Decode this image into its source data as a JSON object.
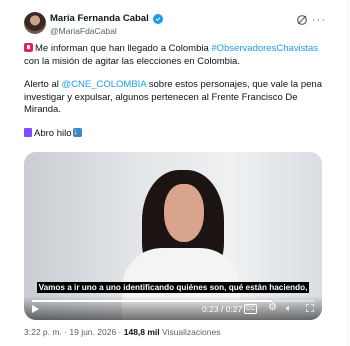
{
  "author": {
    "name": "María Fernanda Cabal",
    "handle": "@MariaFdaCabal",
    "verified_color": "#1d9bf0"
  },
  "header_icons": [
    "grok-icon",
    "more-icon"
  ],
  "tweet": {
    "line1_pre": "Me informan que han llegado a Colombia ",
    "line1_hashtag": "#ObservadoresChavistas",
    "line1_post": " con la misión de agitar las elecciones en Colombia.",
    "line2_pre": "Alerto al ",
    "line2_mention": "@CNE_COLOMBIA",
    "line2_post": " sobre estos personajes, que vale la pena investigar y expulsar, algunos pertenecen al Frente Francisco De Miranda.",
    "line3": "Abro hilo"
  },
  "video": {
    "subtitle": "Vamos a ir uno a uno identificando quiénes son, qué están haciendo,",
    "time": "0:23 / 0:27",
    "progress": 0.85,
    "cc_label": "CC"
  },
  "footer": {
    "time": "3:22 p. m.",
    "separator": " · ",
    "date": "19 jun. 2026",
    "views_count": "148,8 mil",
    "views_label": " Visualizaciones"
  },
  "colors": {
    "link": "#1d9bf0",
    "text": "#0f1419",
    "muted": "#536471"
  }
}
